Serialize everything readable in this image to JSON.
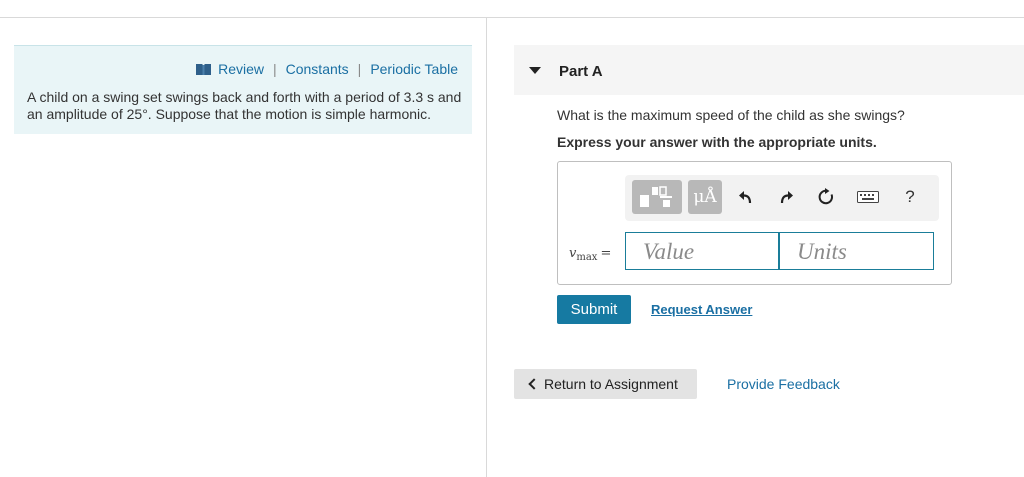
{
  "resources": {
    "review": "Review",
    "constants": "Constants",
    "periodic_table": "Periodic Table",
    "separator": "|"
  },
  "problem": {
    "text": "A child on a swing set swings back and forth with a period of 3.3 s and an amplitude of 25°. Suppose that the motion is simple harmonic."
  },
  "part": {
    "title": "Part A",
    "question": "What is the maximum speed of the child as she swings?",
    "instruction": "Express your answer with the appropriate units."
  },
  "toolbar": {
    "units_button": "μÅ",
    "help_button": "?",
    "icons": [
      "templates-icon",
      "units-icon",
      "undo-icon",
      "redo-icon",
      "reset-icon",
      "keyboard-icon",
      "help-icon"
    ]
  },
  "answer": {
    "variable": "v",
    "subscript": "max",
    "equals": "=",
    "value_placeholder": "Value",
    "units_placeholder": "Units"
  },
  "actions": {
    "submit": "Submit",
    "request_answer": "Request Answer",
    "return_to_assignment": "Return to Assignment",
    "provide_feedback": "Provide Feedback"
  },
  "colors": {
    "link": "#1a6fa3",
    "submit_bg": "#167aa2",
    "panel_bg": "#e9f5f7",
    "field_border": "#1a7d99"
  }
}
